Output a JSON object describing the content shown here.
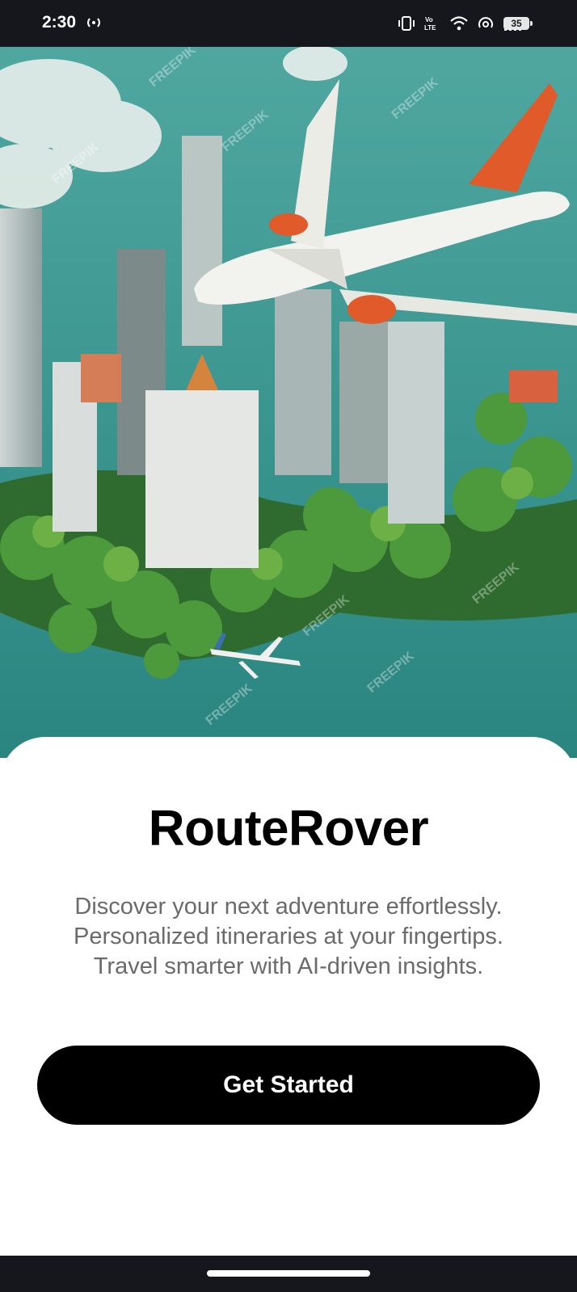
{
  "status_bar": {
    "time": "2:30",
    "battery_level": "35",
    "icons": [
      "hotspot-icon",
      "vibrate-icon",
      "volte-icon",
      "wifi-icon",
      "signal-icon",
      "battery-icon"
    ]
  },
  "hero": {
    "image_description_icon": "travel-city-island-illustration",
    "watermark": "FREEPIK",
    "colors": {
      "water": "#2e8c86",
      "trees": "#3f8f3a",
      "plane_tail": "#e05a2a"
    }
  },
  "content": {
    "app_name": "RouteRover",
    "tagline_lines": [
      "Discover your next adventure effortlessly.",
      "Personalized itineraries at your fingertips.",
      "Travel smarter with AI-driven insights."
    ],
    "cta_label": "Get Started"
  },
  "colors": {
    "status_bar_bg": "#15171c",
    "button_bg": "#000000",
    "button_text": "#ffffff",
    "tagline_text": "#6b6b6b"
  }
}
